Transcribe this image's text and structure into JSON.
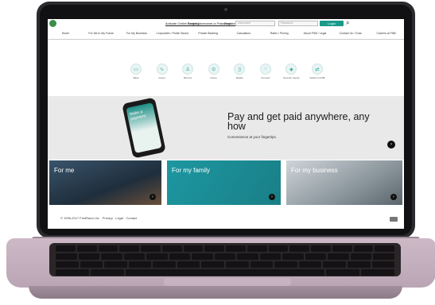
{
  "topbar": {
    "links": [
      "Activate Online Banking",
      "Forgot Username or Password",
      "Register"
    ],
    "username_placeholder": "Username",
    "password_placeholder": "Password",
    "login_label": "Login"
  },
  "nav": {
    "items": [
      "Home",
      "For Me In My Future",
      "For My Business",
      "Corporates / Public Sector",
      "Private Banking",
      "Calculators",
      "Rates / Pricing",
      "About FNB / Legal",
      "Contact Us / Tools",
      "Careers at FNB"
    ]
  },
  "quick_icons": [
    {
      "label": "Bank",
      "icon": "card-icon"
    },
    {
      "label": "Invest",
      "icon": "chart-icon"
    },
    {
      "label": "Borrow",
      "icon": "person-icon"
    },
    {
      "label": "Insure",
      "icon": "shield-icon"
    },
    {
      "label": "Mobile",
      "icon": "phone-icon"
    },
    {
      "label": "Connect",
      "icon": "chat-icon"
    },
    {
      "label": "Security Centre",
      "icon": "lock-icon"
    },
    {
      "label": "Switch to FNB",
      "icon": "switch-icon"
    }
  ],
  "hero": {
    "phone_text": "Make a payment",
    "title": "Pay and get paid anywhere, any how",
    "subtitle": "Convenience at your fingertips."
  },
  "cards": [
    {
      "label": "For me"
    },
    {
      "label": "For my family"
    },
    {
      "label": "For my business"
    }
  ],
  "footer": {
    "copyright": "© 1996-2017 FirstRand Ltd.",
    "links": [
      "Privacy",
      "Legal",
      "Contact"
    ]
  },
  "colors": {
    "accent": "#1a9a8a",
    "laptop_base": "#c4b0bd"
  }
}
